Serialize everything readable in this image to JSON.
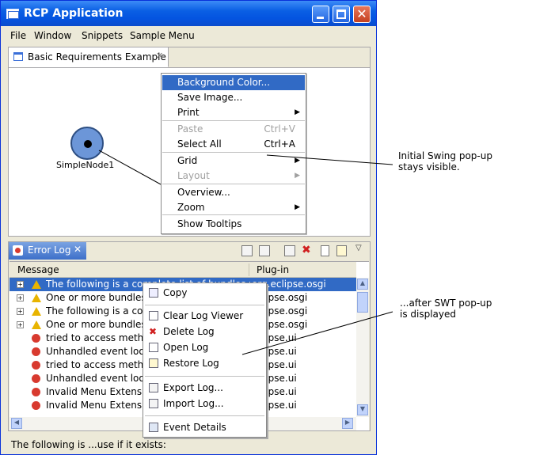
{
  "window": {
    "title": "RCP Application",
    "menu": [
      "File",
      "Window",
      "Snippets",
      "Sample Menu"
    ]
  },
  "editor": {
    "tab_label": "Basic Requirements Example",
    "node_label": "SimpleNode1"
  },
  "swing_popup": {
    "items": [
      {
        "label": "Background Color...",
        "shortcut": "",
        "submenu": false,
        "enabled": true,
        "selected": true
      },
      {
        "label": "Save Image...",
        "shortcut": "",
        "submenu": false,
        "enabled": true
      },
      {
        "label": "Print",
        "shortcut": "",
        "submenu": true,
        "enabled": true
      },
      {
        "label": "Paste",
        "shortcut": "Ctrl+V",
        "submenu": false,
        "enabled": false
      },
      {
        "label": "Select All",
        "shortcut": "Ctrl+A",
        "submenu": false,
        "enabled": true
      },
      {
        "label": "Grid",
        "shortcut": "",
        "submenu": true,
        "enabled": true
      },
      {
        "label": "Layout",
        "shortcut": "",
        "submenu": true,
        "enabled": false
      },
      {
        "label": "Overview...",
        "shortcut": "",
        "submenu": false,
        "enabled": true
      },
      {
        "label": "Zoom",
        "shortcut": "",
        "submenu": true,
        "enabled": true
      },
      {
        "label": "Show Tooltips",
        "shortcut": "",
        "submenu": false,
        "enabled": true
      }
    ]
  },
  "error_log": {
    "tab_label": "Error Log",
    "columns": {
      "message": "Message",
      "plugin": "Plug-in"
    },
    "rows": [
      {
        "type": "warning",
        "expandable": true,
        "message": "The following is a complete list of bundles which",
        "plugin": "org.eclipse.osgi"
      },
      {
        "type": "warning",
        "expandable": true,
        "message": "One or more bundles a",
        "plugin": "eclipse.osgi"
      },
      {
        "type": "warning",
        "expandable": true,
        "message": "The following is a comp",
        "plugin": "eclipse.osgi"
      },
      {
        "type": "warning",
        "expandable": true,
        "message": "One or more bundles a",
        "plugin": "eclipse.osgi"
      },
      {
        "type": "error",
        "expandable": false,
        "message": "tried to access method",
        "plugin": "eclipse.ui"
      },
      {
        "type": "error",
        "expandable": false,
        "message": "Unhandled event loop",
        "plugin": "eclipse.ui"
      },
      {
        "type": "error",
        "expandable": false,
        "message": "tried to access method",
        "plugin": "eclipse.ui"
      },
      {
        "type": "error",
        "expandable": false,
        "message": "Unhandled event loop",
        "plugin": "eclipse.ui"
      },
      {
        "type": "error",
        "expandable": false,
        "message": "Invalid Menu Extension",
        "plugin": "eclipse.ui"
      },
      {
        "type": "error",
        "expandable": false,
        "message": "Invalid Menu Extension",
        "plugin": "eclipse.ui"
      }
    ]
  },
  "swt_popup": {
    "items": [
      {
        "label": "Copy",
        "icon": "copy-icon"
      },
      {
        "label": "Clear Log Viewer",
        "icon": "clear-log-icon"
      },
      {
        "label": "Delete Log",
        "icon": "delete-icon"
      },
      {
        "label": "Open Log",
        "icon": "open-log-icon"
      },
      {
        "label": "Restore Log",
        "icon": "restore-log-icon"
      },
      {
        "label": "Export Log...",
        "icon": "export-log-icon"
      },
      {
        "label": "Import Log...",
        "icon": "import-log-icon"
      },
      {
        "label": "Event Details",
        "icon": "event-details-icon"
      }
    ]
  },
  "status_bar": {
    "text": "The following is ...use if it exists:"
  },
  "annotations": {
    "note1": [
      "Initial Swing pop-up",
      "stays visible."
    ],
    "note2": [
      "...after SWT pop-up",
      "is displayed"
    ]
  }
}
